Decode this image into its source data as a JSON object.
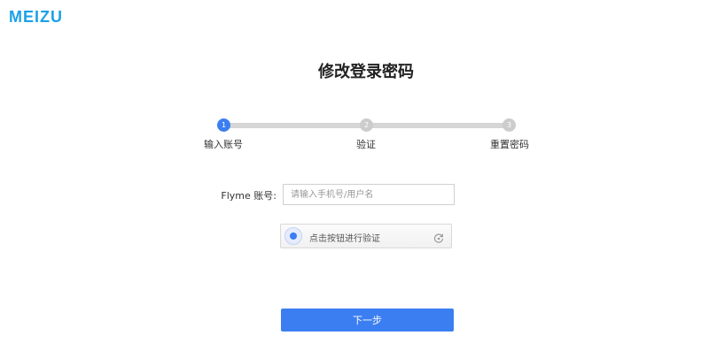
{
  "brand": {
    "logo_text": "MEIZU",
    "color": "#1ba1e6"
  },
  "page": {
    "title": "修改登录密码"
  },
  "steps": {
    "current": 1,
    "progress_fraction": 0.0,
    "items": [
      {
        "number": "1",
        "label": "输入账号",
        "state": "active"
      },
      {
        "number": "2",
        "label": "验证",
        "state": "pending"
      },
      {
        "number": "3",
        "label": "重置密码",
        "state": "pending"
      }
    ]
  },
  "form": {
    "account_label": "Flyme 账号:",
    "account_value": "",
    "account_placeholder": "请输入手机号/用户名",
    "captcha_text": "点击按钮进行验证",
    "captcha_icon": "radar-icon",
    "refresh_icon": "refresh-icon"
  },
  "actions": {
    "next_label": "下一步"
  },
  "colors": {
    "accent": "#3b7ef1",
    "inactive_step": "#cccccc",
    "track": "#d6d6d6"
  }
}
